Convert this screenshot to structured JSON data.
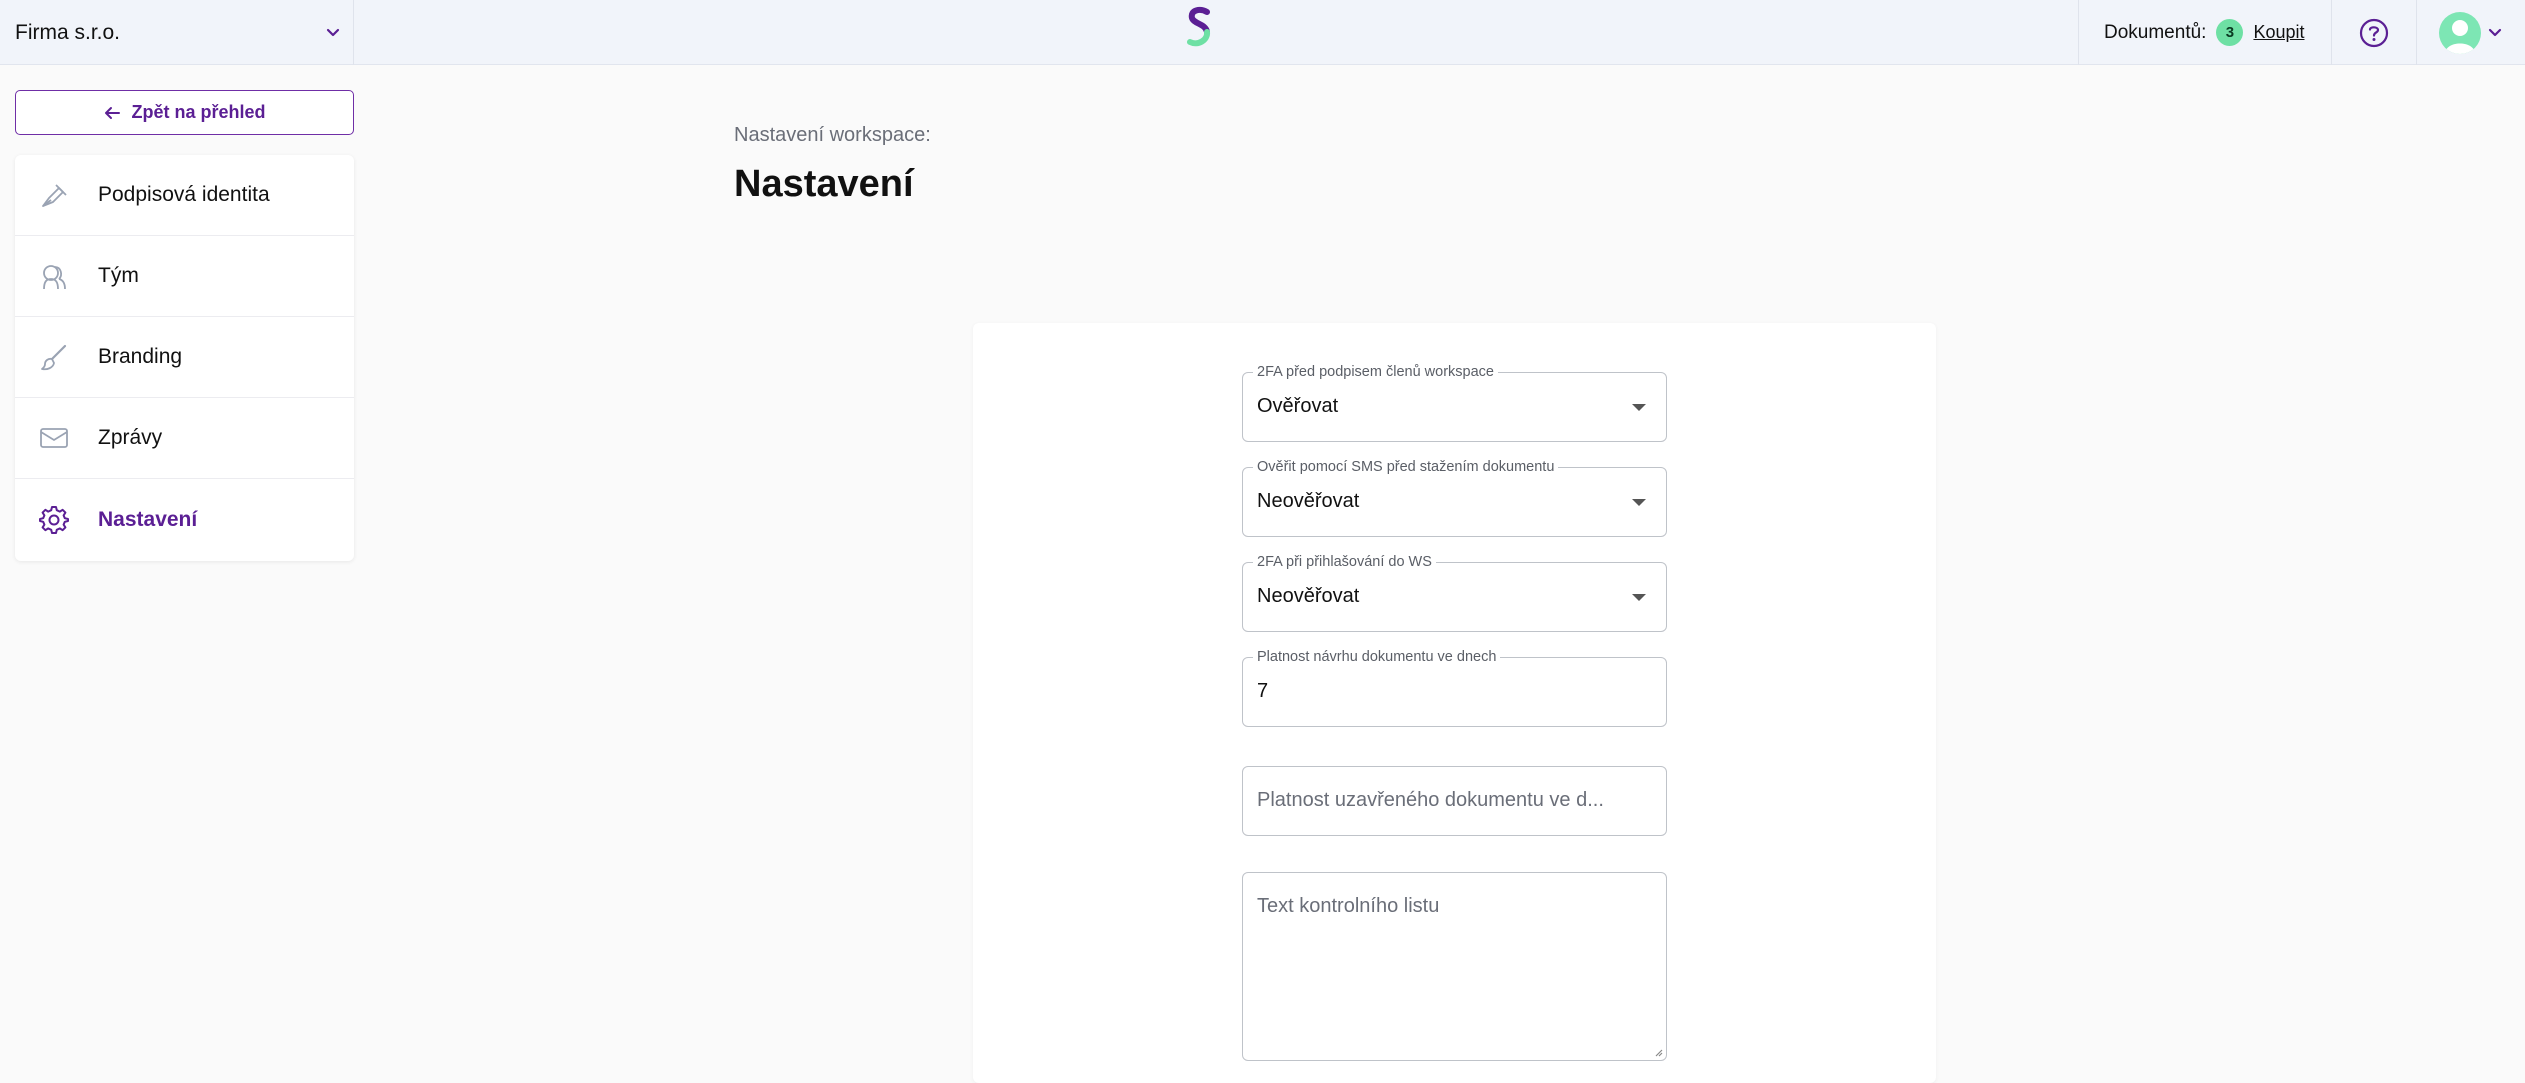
{
  "header": {
    "company_name": "Firma s.r.o.",
    "documents_label": "Dokumentů:",
    "documents_count": "3",
    "buy_link": "Koupit",
    "brand_color": "#5b1f94",
    "accent_green": "#6ee0a4"
  },
  "sidebar": {
    "back_button": "Zpět na přehled",
    "items": [
      {
        "label": "Podpisová identita",
        "icon": "pen-nib-icon",
        "active": false
      },
      {
        "label": "Tým",
        "icon": "team-icon",
        "active": false
      },
      {
        "label": "Branding",
        "icon": "brush-icon",
        "active": false
      },
      {
        "label": "Zprávy",
        "icon": "envelope-icon",
        "active": false
      },
      {
        "label": "Nastavení",
        "icon": "gear-icon",
        "active": true
      }
    ]
  },
  "main": {
    "subtitle": "Nastavení workspace:",
    "title": "Nastavení",
    "fields": {
      "twofa_members": {
        "label": "2FA před podpisem členů workspace",
        "value": "Ověřovat"
      },
      "sms_download": {
        "label": "Ověřit pomocí SMS před stažením dokumentu",
        "value": "Neověřovat"
      },
      "twofa_login": {
        "label": "2FA při přihlašování do WS",
        "value": "Neověřovat"
      },
      "draft_validity": {
        "label": "Platnost návrhu dokumentu ve dnech",
        "value": "7"
      },
      "closed_validity": {
        "placeholder": "Platnost uzavřeného dokumentu ve d..."
      },
      "control_sheet": {
        "placeholder": "Text kontrolního listu"
      }
    }
  }
}
